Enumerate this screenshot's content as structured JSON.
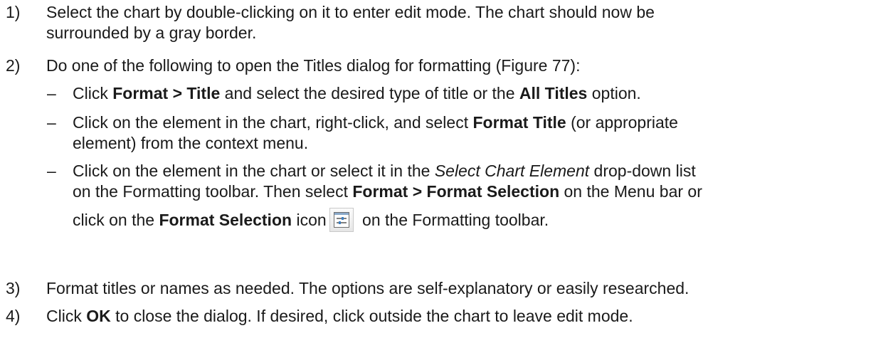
{
  "steps": [
    {
      "num": "1)",
      "text_a": "Select the chart by double-clicking on it to enter edit mode. The chart should now be",
      "text_b": "surrounded by a gray border."
    },
    {
      "num": "2)",
      "text": "Do one of the following to open the Titles dialog for formatting (Figure 77):",
      "bullets": [
        {
          "dash": "–",
          "p1": "Click ",
          "b1": "Format > Title",
          "p2": " and select the desired type of title or the ",
          "b2": "All Titles",
          "p3": " option."
        },
        {
          "dash": "–",
          "p1": "Click on the element in the chart, right-click, and select ",
          "b1": "Format Title",
          "p2": " (or appropriate",
          "p3": "element) from the context menu."
        },
        {
          "dash": "–",
          "p1": "Click on the element in the chart or select it in the ",
          "i1": "Select Chart Element",
          "p2": " drop-down list",
          "p3": "on the Formatting toolbar. Then select ",
          "b1": "Format > Format Selection",
          "p4": " on the Menu bar or",
          "p5": "click on the ",
          "b2": "Format Selection",
          "p6": " icon",
          "icon": "format-selection-icon",
          "p7": " on the Formatting toolbar."
        }
      ]
    },
    {
      "num": "3)",
      "text": "Format titles or names as needed. The options are self-explanatory or easily researched."
    },
    {
      "num": "4)",
      "p1": "Click ",
      "b1": "OK",
      "p2": " to close the dialog. If desired, click outside the chart to leave edit mode."
    }
  ]
}
